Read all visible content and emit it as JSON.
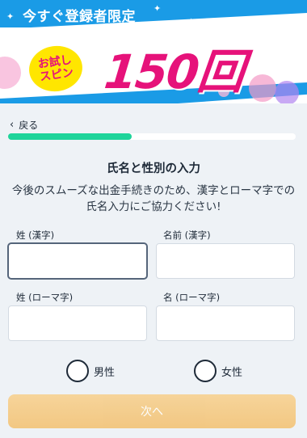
{
  "banner": {
    "headline": "今すぐ登録者限定",
    "badge_line1": "お試し",
    "badge_line2": "スピン",
    "count": "150回",
    "colors": {
      "blue": "#1a9be6",
      "pink": "#e6127a",
      "yellow": "#ffe600"
    }
  },
  "nav": {
    "back_icon": "chevron-left-icon",
    "back_label": "戻る",
    "progress": 0.43
  },
  "form": {
    "title": "氏名と性別の入力",
    "description": "今後のスムーズな出金手続きのため、漢字とローマ字での氏名入力にご協力ください!",
    "fields": {
      "last_name_kanji": {
        "label": "姓 (漢字)",
        "value": ""
      },
      "first_name_kanji": {
        "label": "名前 (漢字)",
        "value": ""
      },
      "last_name_roman": {
        "label": "姓 (ローマ字)",
        "value": ""
      },
      "first_name_roman": {
        "label": "名 (ローマ字)",
        "value": ""
      }
    },
    "gender": {
      "male": "男性",
      "female": "女性"
    },
    "next_label": "次へ"
  }
}
